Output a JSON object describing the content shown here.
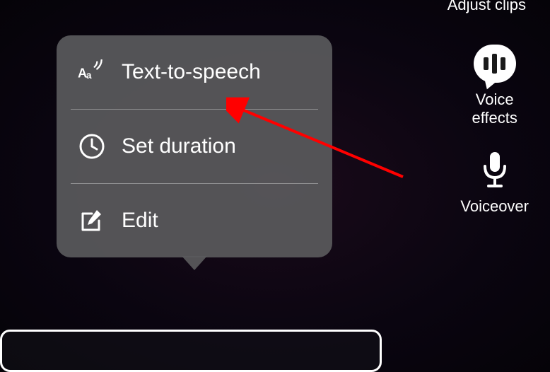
{
  "popup": {
    "items": [
      {
        "label": "Text-to-speech",
        "icon": "tts-icon"
      },
      {
        "label": "Set duration",
        "icon": "clock-icon"
      },
      {
        "label": "Edit",
        "icon": "edit-icon"
      }
    ]
  },
  "sidebar": {
    "adjust_clips_label": "Adjust clips",
    "voice_effects_label": "Voice\neffects",
    "voiceover_label": "Voiceover"
  },
  "annotation": {
    "arrow_color": "#ff0000"
  }
}
